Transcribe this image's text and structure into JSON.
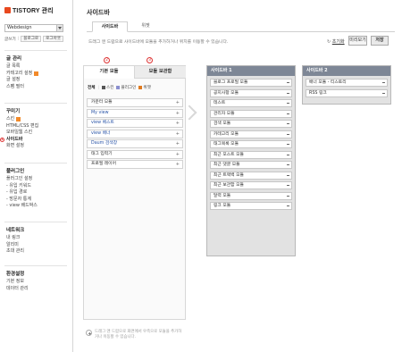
{
  "app": {
    "logo_text": "TISTORY 관리",
    "blog_name": "Webdesign",
    "quick_links": [
      "글쓰기",
      "블로그로",
      "로그아웃"
    ]
  },
  "left_menu": [
    {
      "title": "글 관리",
      "items": [
        {
          "label": "글 목록"
        },
        {
          "label": "카테고리 설정",
          "badge": "N"
        },
        {
          "label": "글 설정"
        },
        {
          "label": "스팸 필터"
        }
      ]
    },
    {
      "title": "꾸미기",
      "items": [
        {
          "label": "스킨",
          "badge": "N"
        },
        {
          "label": "HTML/CSS 편집"
        },
        {
          "label": "모바일웹 스킨"
        },
        {
          "label": "사이드바",
          "active": true,
          "marker": "1"
        },
        {
          "label": "화면 설정"
        }
      ]
    },
    {
      "title": "플러그인",
      "items": [
        {
          "label": "플러그인 설정"
        },
        {
          "label": "- 유입 키워드"
        },
        {
          "label": "- 유입 경로"
        },
        {
          "label": "- 방문자 통계"
        },
        {
          "label": "- view 배드박스"
        }
      ]
    },
    {
      "title": "네트워크",
      "items": [
        {
          "label": "내 링크"
        },
        {
          "label": "알리미"
        },
        {
          "label": "초대 관리"
        }
      ]
    },
    {
      "title": "환경설정",
      "items": [
        {
          "label": "기본 정보"
        },
        {
          "label": "데이터 관리"
        }
      ]
    }
  ],
  "page": {
    "title": "사이드바",
    "tabs": [
      "사이드바",
      "위젯"
    ],
    "info": "드래그 앤 드랍으로 사이드바에 모듈을 추가하거나 위치를 이동할 수 있습니다.",
    "reset_label": "초기화",
    "preview_label": "미리보기",
    "save_label": "저장"
  },
  "module_panel": {
    "tabs": [
      "기본 모듈",
      "모듈 보관함"
    ],
    "tab_markers": [
      "2",
      "3"
    ],
    "filters": [
      {
        "label": "전체",
        "color": ""
      },
      {
        "label": "스킨",
        "color": "#555555"
      },
      {
        "label": "플러그인",
        "color": "#8a8fcf"
      },
      {
        "label": "위젯",
        "color": "#e07a1f"
      }
    ],
    "modules": [
      {
        "label": "카운터 모듈",
        "blue": false
      },
      {
        "label": "My view",
        "blue": true
      },
      {
        "label": "view 베스트",
        "blue": true
      },
      {
        "label": "view 배너",
        "blue": true
      },
      {
        "label": "Daum 검색창",
        "blue": true
      },
      {
        "label": "태그 입력기",
        "blue": false
      },
      {
        "label": "프로필 레이어",
        "blue": false
      }
    ],
    "bottom_note": "드래그 앤 드랍으로 화면에서 우측으로 모듈을 추가하거나 이동할 수 있습니다."
  },
  "sidebar1": {
    "title": "사이드바 1",
    "items": [
      "블로그 프로필 모듈",
      "공지사항 모듈",
      "테스트",
      "관리자 모듈",
      "검색 모듈",
      "카테고리 모듈",
      "태그목록 모듈",
      "최근 포스트 모듈",
      "최근 댓글 모듈",
      "최근 트랙백 모듈",
      "최근 보관함 모듈",
      "달력 모듈",
      "링크 모듈"
    ]
  },
  "sidebar2": {
    "title": "사이드바 2",
    "items": [
      "배너 모듈 - 티스토리",
      "RSS 링크"
    ]
  }
}
